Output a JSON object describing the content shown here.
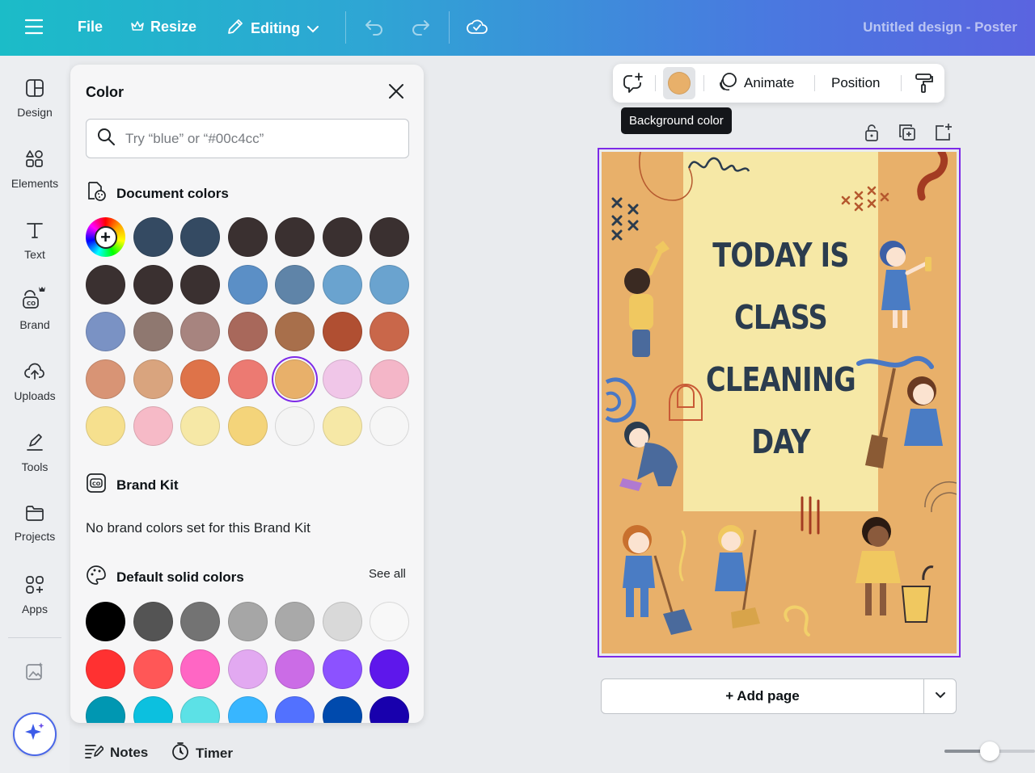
{
  "topbar": {
    "menu_icon": "hamburger-icon",
    "file_label": "File",
    "resize_label": "Resize",
    "resize_icon": "crown-icon",
    "editing_label": "Editing",
    "editing_icon": "pencil-icon",
    "undo_icon": "undo-icon",
    "redo_icon": "redo-icon",
    "save_icon": "cloud-check-icon",
    "doc_title": "Untitled design - Poster"
  },
  "rail": {
    "items": [
      {
        "label": "Design",
        "icon": "design-icon"
      },
      {
        "label": "Elements",
        "icon": "elements-icon"
      },
      {
        "label": "Text",
        "icon": "text-icon"
      },
      {
        "label": "Brand",
        "icon": "brand-icon"
      },
      {
        "label": "Uploads",
        "icon": "uploads-icon"
      },
      {
        "label": "Tools",
        "icon": "tools-icon"
      },
      {
        "label": "Projects",
        "icon": "projects-icon"
      },
      {
        "label": "Apps",
        "icon": "apps-icon"
      }
    ],
    "magic_icon": "sparkle-icon"
  },
  "color_panel": {
    "title": "Color",
    "search_placeholder": "Try “blue” or “#00c4cc”",
    "document_colors_title": "Document colors",
    "document_colors": [
      "#344a62",
      "#344a62",
      "#3a3030",
      "#3a3030",
      "#3a3030",
      "#3a3030",
      "#3a3030",
      "#3a3030",
      "#3a3030",
      "#5b8fc6",
      "#5f84a8",
      "#6aa3cf",
      "#6aa3cf",
      "#7a92c4",
      "#8f7870",
      "#a7847f",
      "#a8685b",
      "#a86f4b",
      "#b04f32",
      "#c9674a",
      "#d89475",
      "#d9a47e",
      "#de7349",
      "#ec7a72",
      "#e8b06a",
      "#f0c6e8",
      "#f4b6c8",
      "#f6e08e",
      "#f6bac7",
      "#f6e8a6",
      "#f4d47a",
      "#f4f4f4",
      "#f6e8a6",
      "#f6f6f6"
    ],
    "selected_color": "#e8b06a",
    "brand_kit_title": "Brand Kit",
    "no_brand_text": "No brand colors set for this Brand Kit",
    "default_colors_title": "Default solid colors",
    "see_all_label": "See all",
    "default_colors": [
      "#000000",
      "#545454",
      "#737373",
      "#a6a6a6",
      "#a9a9a9",
      "#d9d9d9",
      "#f8f8f8",
      "#ff3131",
      "#ff5757",
      "#ff66c4",
      "#e2a9f1",
      "#cb6ce6",
      "#8c52ff",
      "#5e17eb",
      "#0097b2",
      "#0cc0df",
      "#5ce1e6",
      "#38b6ff",
      "#5271ff",
      "#004aad",
      "#1800ad"
    ]
  },
  "context_toolbar": {
    "comment_icon": "comment-add-icon",
    "background_color": "#e8b06a",
    "animate_label": "Animate",
    "animate_icon": "animate-icon",
    "position_label": "Position",
    "paint_icon": "paint-roller-icon",
    "tooltip": "Background color"
  },
  "page_tools": {
    "lock_icon": "lock-icon",
    "duplicate_icon": "duplicate-icon",
    "add_icon": "add-page-icon"
  },
  "poster": {
    "lines": [
      "TODAY IS",
      "CLASS",
      "CLEANING",
      "DAY"
    ],
    "background": "#e8b06a",
    "panel_color": "#f6e8a6",
    "text_color": "#2b3c4e"
  },
  "add_page": {
    "label": "+ Add page",
    "chevron_icon": "chevron-down-icon"
  },
  "bottombar": {
    "notes_label": "Notes",
    "notes_icon": "notes-icon",
    "timer_label": "Timer",
    "timer_icon": "timer-icon",
    "zoom_fraction": 0.5
  }
}
